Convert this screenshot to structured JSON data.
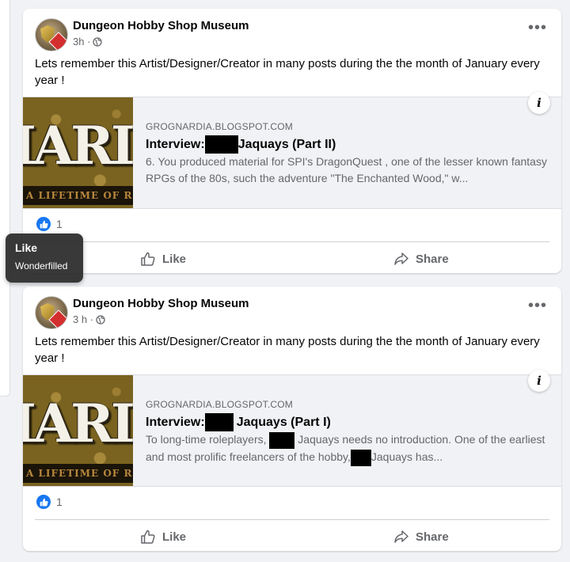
{
  "posts": [
    {
      "author": "Dungeon Hobby Shop Museum",
      "time": "3h ·",
      "text": "Lets remember this Artist/Designer/Creator in many posts during the the month of January every year !",
      "link": {
        "domain": "GROGNARDIA.BLOGSPOT.COM",
        "title_prefix": "Interview:",
        "title_suffix": "Jaquays (Part II)",
        "desc_1": "6. You produced material for SPI's DragonQuest , one of the lesser known fantasy RPGs of the 80s, such the adventure \"The Enchanted Wood,\" w...",
        "thumb_text": "IARI",
        "thumb_strip": "A LIFETIME OF RO"
      },
      "reaction_count": "1",
      "like_label": "Like",
      "share_label": "Share"
    },
    {
      "author": "Dungeon Hobby Shop Museum",
      "time": "3 h ·",
      "text": "Lets remember this Artist/Designer/Creator in many posts during the the month of January every year !",
      "link": {
        "domain": "GROGNARDIA.BLOGSPOT.COM",
        "title_prefix": "Interview:",
        "title_suffix": "Jaquays (Part I)",
        "desc_1": "To long-time roleplayers,",
        "desc_2": "Jaquays needs no introduction. One of the earliest and most prolific freelancers of the hobby,",
        "desc_3": "Jaquays has...",
        "thumb_text": "IARI",
        "thumb_strip": "A LIFETIME OF RO"
      },
      "reaction_count": "1",
      "like_label": "Like",
      "share_label": "Share"
    }
  ],
  "tooltip": {
    "title": "Like",
    "user": "Wonderfilled"
  },
  "colors": {
    "accent": "#1877f2",
    "background": "#f0f2f5",
    "secondary_text": "#65676b"
  }
}
